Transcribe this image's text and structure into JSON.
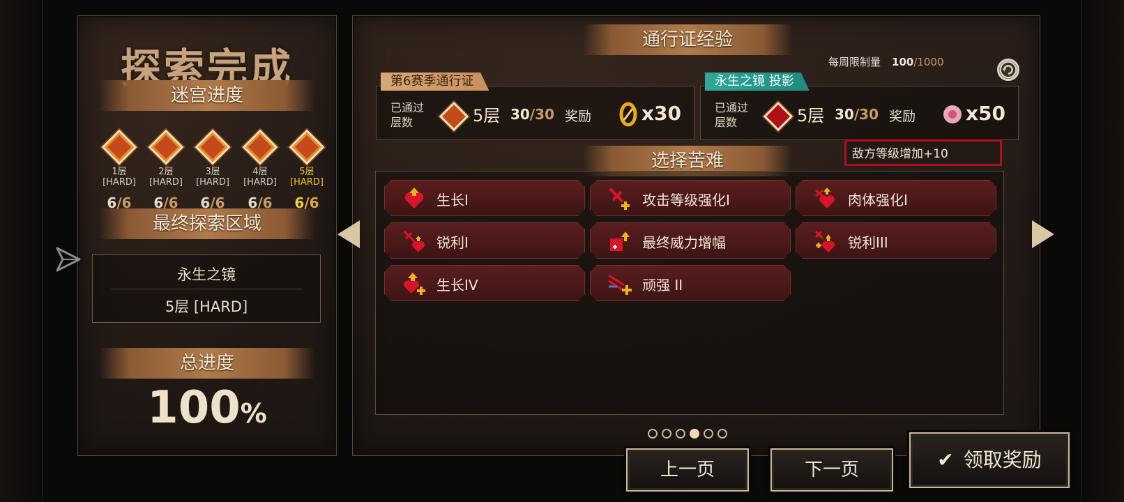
{
  "left": {
    "title": "探索完成",
    "maze_progress_label": "迷宫进度",
    "floors": [
      {
        "label": "1层",
        "difficulty": "[HARD]",
        "count": "6",
        "total": "/6"
      },
      {
        "label": "2层",
        "difficulty": "[HARD]",
        "count": "6",
        "total": "/6"
      },
      {
        "label": "3层",
        "difficulty": "[HARD]",
        "count": "6",
        "total": "/6"
      },
      {
        "label": "4层",
        "difficulty": "[HARD]",
        "count": "6",
        "total": "/6"
      },
      {
        "label": "5层",
        "difficulty": "[HARD]",
        "count": "6",
        "total": "/6"
      }
    ],
    "final_region_label": "最终探索区域",
    "final_region_name": "永生之镜",
    "final_region_floor": "5层 [HARD]",
    "total_progress_label": "总进度",
    "total_progress_value": "100",
    "total_progress_unit": "%"
  },
  "pass": {
    "header": "通行证经验",
    "season": {
      "tag": "第6赛季通行证",
      "passed_label_1": "已通过",
      "passed_label_2": "层数",
      "floor": "5层",
      "progress": "30",
      "progress_total": "/30",
      "reward_label": "奖励",
      "reward_mult": "x30"
    },
    "mirror": {
      "tag": "永生之镜 投影",
      "weekly_label": "每周限制量",
      "weekly_value": "100",
      "weekly_total": "/1000",
      "passed_label_1": "已通过",
      "passed_label_2": "层数",
      "floor": "5层",
      "progress": "30",
      "progress_total": "/30",
      "reward_label": "奖励",
      "reward_mult": "x50"
    }
  },
  "hardship": {
    "header": "选择苦难",
    "enemy_level": "敌方等级增加+10",
    "items": [
      {
        "label": "生长I",
        "icon": "heart-growth-icon"
      },
      {
        "label": "攻击等级强化I",
        "icon": "sword-plus-icon"
      },
      {
        "label": "肉体强化I",
        "icon": "heart-shield-icon"
      },
      {
        "label": "锐利I",
        "icon": "sword-heart-icon"
      },
      {
        "label": "最终威力增幅",
        "icon": "power-boost-icon"
      },
      {
        "label": "锐利III",
        "icon": "sharp-boost-icon"
      },
      {
        "label": "生长IV",
        "icon": "heart-plus-icon"
      },
      {
        "label": "顽强 II",
        "icon": "tenacity-icon"
      }
    ]
  },
  "pagination": {
    "total_pages": 6,
    "current_page": 4
  },
  "buttons": {
    "prev": "上一页",
    "next": "下一页",
    "claim": "领取奖励"
  },
  "colors": {
    "accent_gold": "#f2c230",
    "teal_tag": "#2fa89a",
    "brown_tag": "#d9a774",
    "card_red": "#5a1e1e",
    "enemy_border": "#b0101a"
  }
}
